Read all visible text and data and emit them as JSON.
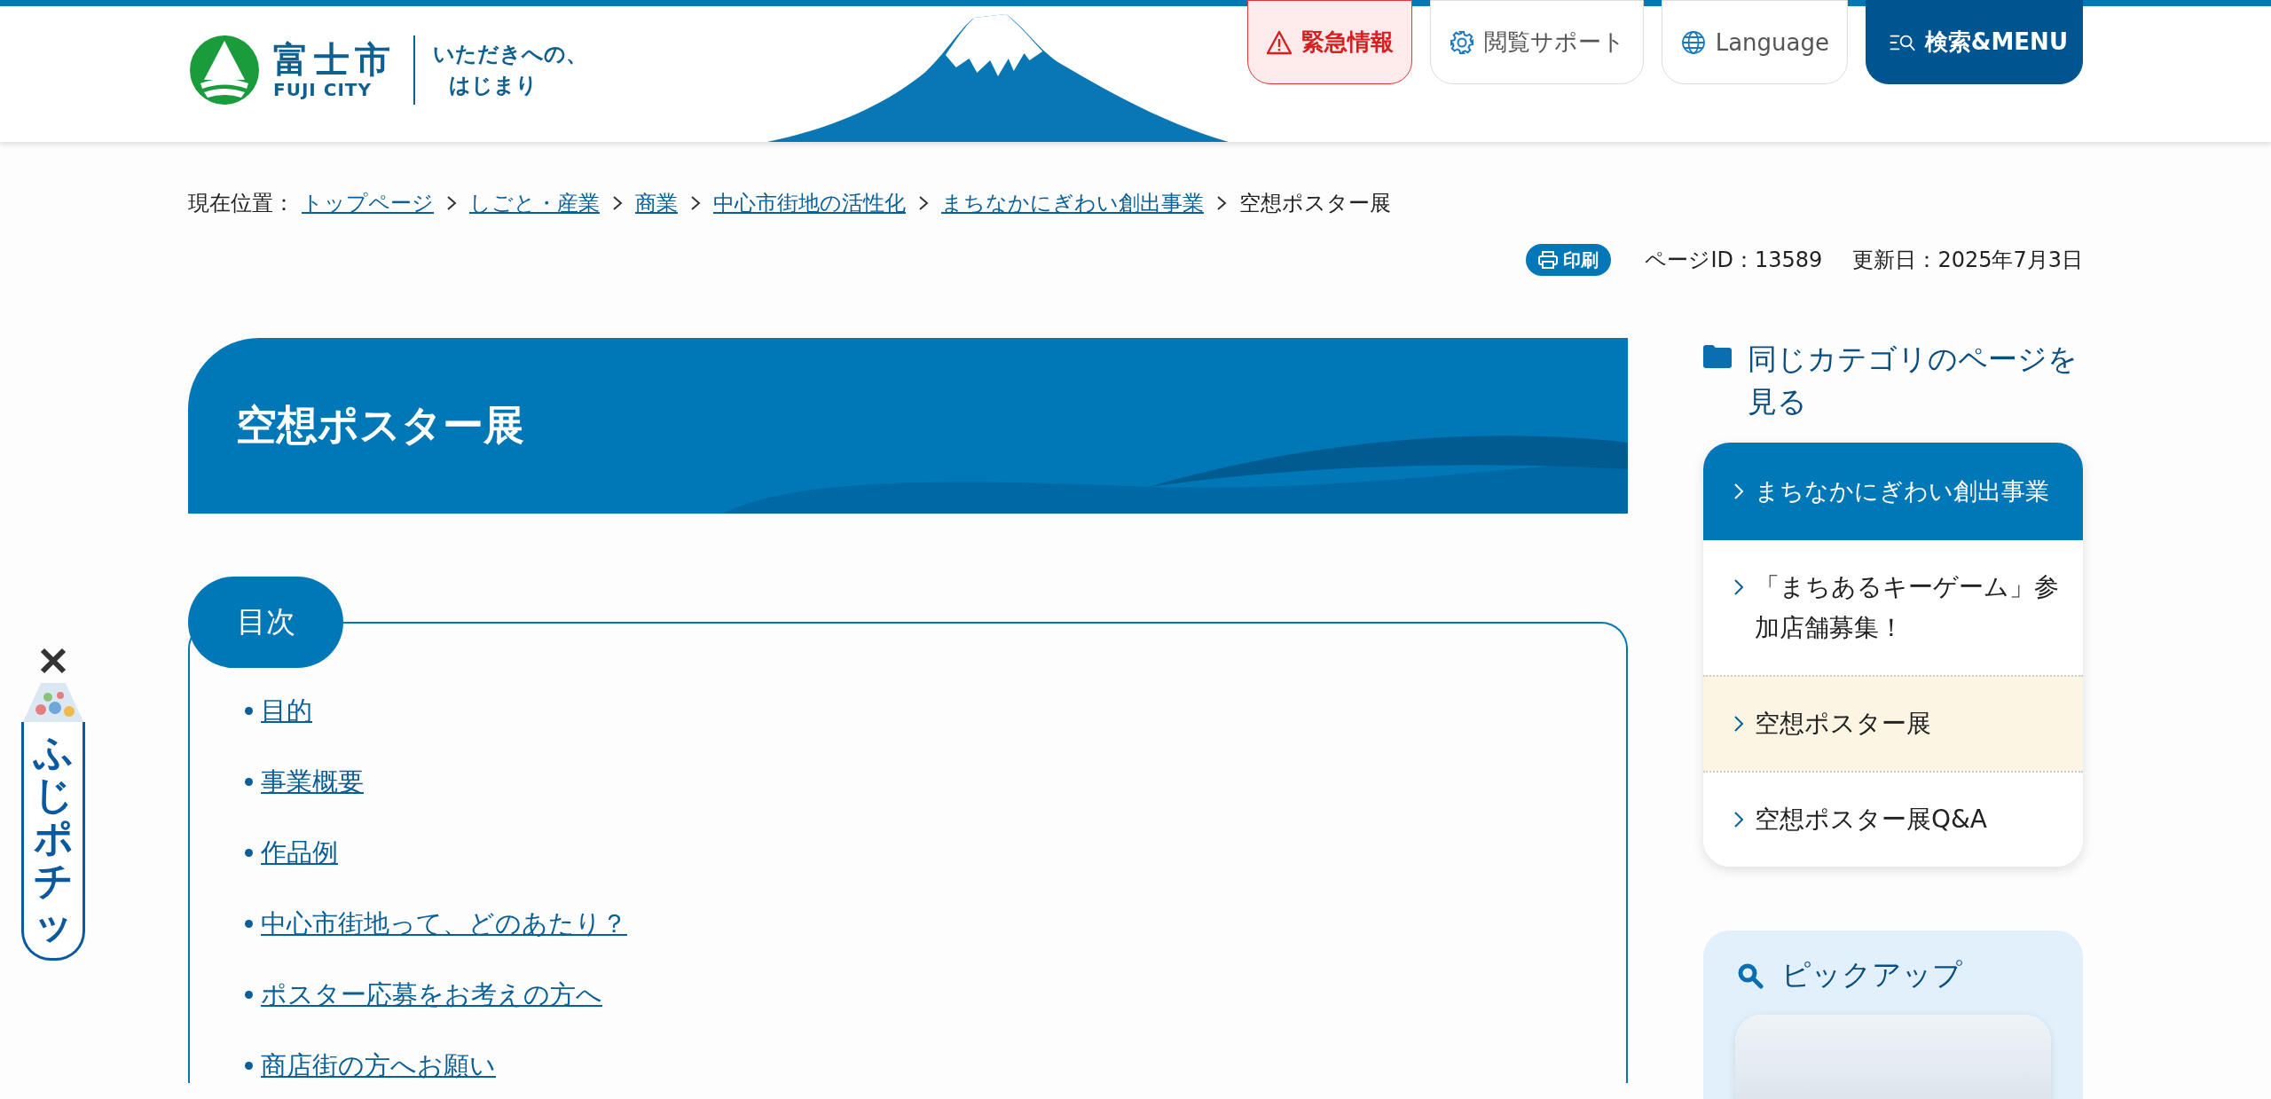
{
  "header": {
    "logo": {
      "name": "富士市",
      "name_en": "FUJI CITY",
      "tagline": [
        "いただきへの、",
        "はじまり"
      ]
    },
    "buttons": [
      {
        "kind": "alert",
        "label": "緊急情報"
      },
      {
        "kind": "support",
        "label": "閲覧サポート"
      },
      {
        "kind": "language",
        "label": "Language"
      },
      {
        "kind": "menu",
        "label": "検索&MENU"
      }
    ]
  },
  "breadcrumb": {
    "label": "現在位置：",
    "items": [
      {
        "label": "トップページ",
        "link": true
      },
      {
        "label": "しごと・産業",
        "link": true
      },
      {
        "label": "商業",
        "link": true
      },
      {
        "label": "中心市街地の活性化",
        "link": true
      },
      {
        "label": "まちなかにぎわい創出事業",
        "link": true
      },
      {
        "label": "空想ポスター展",
        "link": false
      }
    ]
  },
  "page_meta": {
    "print": "印刷",
    "page_id": "ページID：13589",
    "updated": "更新日：2025年7月3日"
  },
  "title": "空想ポスター展",
  "toc": {
    "heading": "目次",
    "items": [
      "目的",
      "事業概要",
      "作品例",
      "中心市街地って、どのあたり？",
      "ポスター応募をお考えの方へ",
      "商店街の方へお願い"
    ]
  },
  "sidebar": {
    "heading": "同じカテゴリのページを見る",
    "items": [
      {
        "kind": "category",
        "label": "まちなかにぎわい創出事業",
        "selected": false
      },
      {
        "kind": "page",
        "label": "「まちあるキーゲーム」参加店舗募集！",
        "selected": false
      },
      {
        "kind": "page",
        "label": "空想ポスター展",
        "selected": true
      },
      {
        "kind": "page",
        "label": "空想ポスター展Q&A",
        "selected": false
      }
    ]
  },
  "pickup": {
    "heading": "ピックアップ"
  },
  "fuji_pochi": {
    "label": "ふじポチッ"
  }
}
